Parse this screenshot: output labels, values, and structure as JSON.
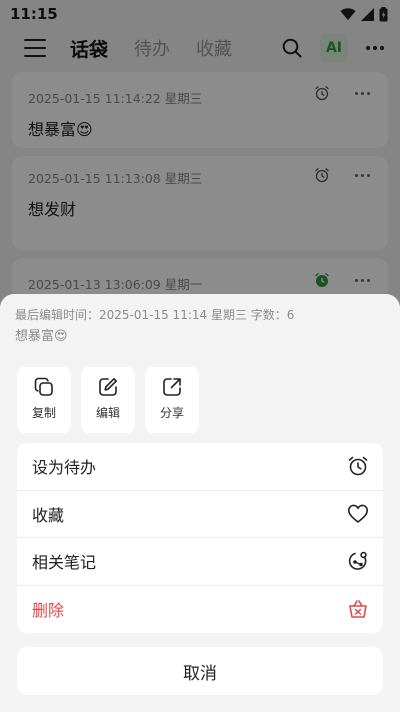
{
  "status_bar": {
    "time": "11:15"
  },
  "header": {
    "tabs": [
      {
        "label": "话袋",
        "active": true
      },
      {
        "label": "待办",
        "active": false
      },
      {
        "label": "收藏",
        "active": false
      }
    ],
    "ai_label": "AI"
  },
  "notes": [
    {
      "date": "2025-01-15 11:14:22 星期三",
      "text": "想暴富😍"
    },
    {
      "date": "2025-01-15 11:13:08 星期三",
      "text": "想发财"
    },
    {
      "date": "2025-01-13 13:06:09 星期一",
      "text": ""
    }
  ],
  "sheet": {
    "meta": "最后编辑时间：2025-01-15 11:14 星期三 字数：6",
    "preview": "想暴富😍",
    "quick_actions": [
      {
        "label": "复制",
        "icon": "copy-icon"
      },
      {
        "label": "编辑",
        "icon": "edit-icon"
      },
      {
        "label": "分享",
        "icon": "share-icon"
      }
    ],
    "options": [
      {
        "label": "设为待办",
        "icon": "alarm-clock-icon"
      },
      {
        "label": "收藏",
        "icon": "heart-icon"
      },
      {
        "label": "相关笔记",
        "icon": "related-notes-icon"
      },
      {
        "label": "删除",
        "icon": "basket-delete-icon"
      }
    ],
    "cancel_label": "取消"
  },
  "colors": {
    "accent_green": "#2e9a45",
    "danger_red": "#e04848"
  }
}
